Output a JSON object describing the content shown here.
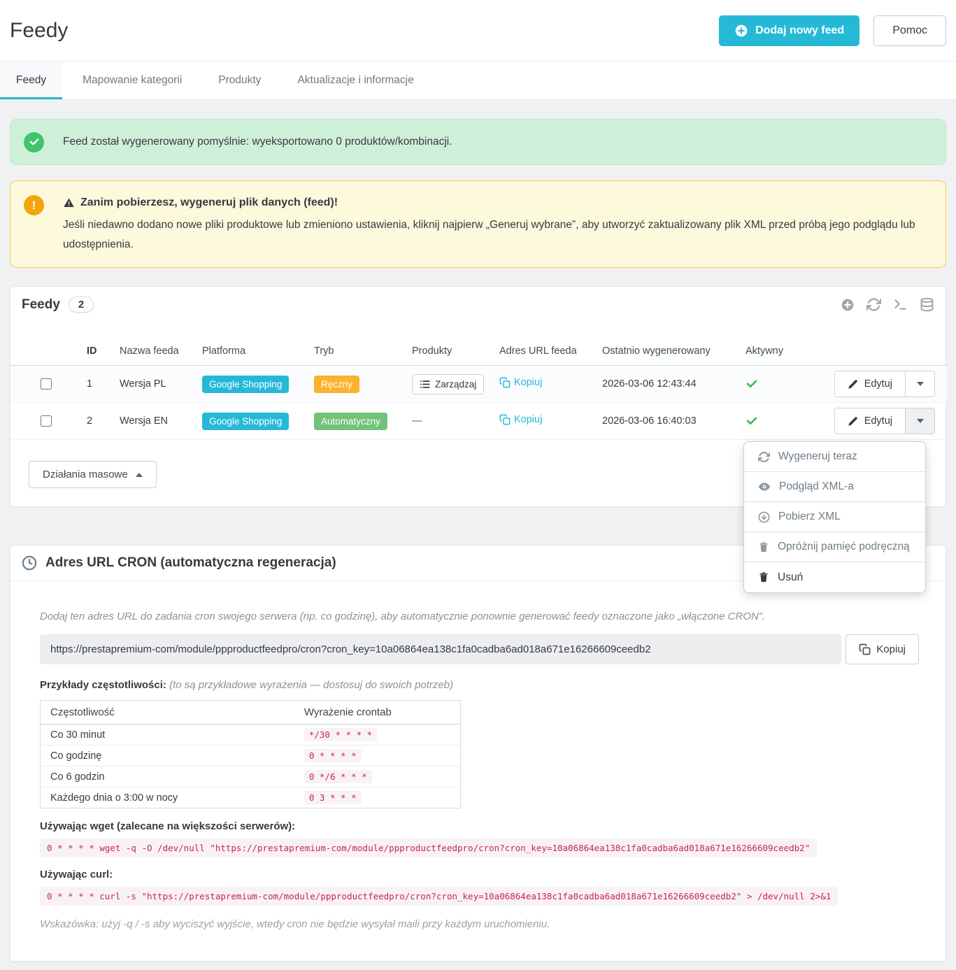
{
  "colors": {
    "accent": "#25b9d7",
    "success_icon": "#3ec46d",
    "warning_icon": "#f2a50c",
    "badge_platform": "#25b9d7",
    "badge_manual": "#fbb22e",
    "badge_auto": "#72c279",
    "code_text": "#c7254e"
  },
  "page": {
    "title": "Feedy",
    "add_button": "Dodaj nowy feed",
    "help_button": "Pomoc"
  },
  "tabs": [
    {
      "label": "Feedy"
    },
    {
      "label": "Mapowanie kategorii"
    },
    {
      "label": "Produkty"
    },
    {
      "label": "Aktualizacje i informacje"
    }
  ],
  "alerts": {
    "success_text": "Feed został wygenerowany pomyślnie: wyeksportowano 0 produktów/kombinacji.",
    "warning_title": "Zanim pobierzesz, wygeneruj plik danych (feed)!",
    "warning_body": "Jeśli niedawno dodano nowe pliki produktowe lub zmieniono ustawienia, kliknij najpierw „Generuj wybrane”, aby utworzyć zaktualizowany plik XML przed próbą jego podglądu lub udostępnienia."
  },
  "feeds": {
    "panel_title": "Feedy",
    "count": "2",
    "columns": {
      "id": "ID",
      "name": "Nazwa feeda",
      "platform": "Platforma",
      "mode": "Tryb",
      "products": "Produkty",
      "url": "Adres URL feeda",
      "generated": "Ostatnio wygenerowany",
      "active": "Aktywny"
    },
    "rows": [
      {
        "id": "1",
        "name": "Wersja PL",
        "platform": "Google Shopping",
        "mode": "Ręczny",
        "products_button": "Zarządzaj",
        "copy_link": "Kopiuj",
        "generated": "2026-03-06 12:43:44",
        "edit_button": "Edytuj"
      },
      {
        "id": "2",
        "name": "Wersja EN",
        "platform": "Google Shopping",
        "mode": "Automatyczny",
        "products_empty": "—",
        "copy_link": "Kopiuj",
        "generated": "2026-03-06 16:40:03",
        "edit_button": "Edytuj"
      }
    ],
    "bulk_button": "Działania masowe"
  },
  "dropdown": {
    "items": [
      {
        "icon": "refresh-icon",
        "label": "Wygeneruj teraz"
      },
      {
        "icon": "eye-icon",
        "label": "Podgląd XML-a"
      },
      {
        "icon": "download-icon",
        "label": "Pobierz XML"
      },
      {
        "icon": "trash-icon",
        "label": "Opróżnij pamięć podręczną"
      },
      {
        "icon": "trash-icon",
        "label": "Usuń"
      }
    ]
  },
  "cron": {
    "panel_title": "Adres URL CRON (automatyczna regeneracja)",
    "intro": "Dodaj ten adres URL do zadania cron swojego serwera (np. co godzinę), aby automatycznie ponownie generować feedy oznaczone jako „włączone CRON”.",
    "url": "https://prestapremium-com/module/ppproductfeedpro/cron?cron_key=10a06864ea138c1fa0cadba6ad018a671e16266609ceedb2",
    "copy_button": "Kopiuj",
    "examples_label": "Przykłady częstotliwości:",
    "examples_note": "(to są przykładowe wyrażenia — dostosuj do swoich potrzeb)",
    "freq_columns": {
      "freq": "Częstotliwość",
      "cron": "Wyrażenie crontab"
    },
    "freq_rows": [
      {
        "freq": "Co 30 minut",
        "cron": "*/30 * * * *"
      },
      {
        "freq": "Co godzinę",
        "cron": "0 * * * *"
      },
      {
        "freq": "Co 6 godzin",
        "cron": "0 */6 * * *"
      },
      {
        "freq": "Każdego dnia o 3:00 w nocy",
        "cron": "0 3 * * *"
      }
    ],
    "wget_label": "Używając wget (zalecane na większości serwerów):",
    "wget_cmd": "0 * * * * wget -q -O /dev/null \"https://prestapremium-com/module/ppproductfeedpro/cron?cron_key=10a06864ea138c1fa0cadba6ad018a671e16266609ceedb2\"",
    "curl_label": "Używając curl:",
    "curl_cmd": "0 * * * * curl -s \"https://prestapremium-com/module/ppproductfeedpro/cron?cron_key=10a06864ea138c1fa0cadba6ad018a671e16266609ceedb2\" > /dev/null 2>&1",
    "hint": "Wskazówka: użyj -q / -s aby wyciszyć wyjście, wtedy cron nie będzie wysyłał maili przy każdym uruchomieniu."
  }
}
